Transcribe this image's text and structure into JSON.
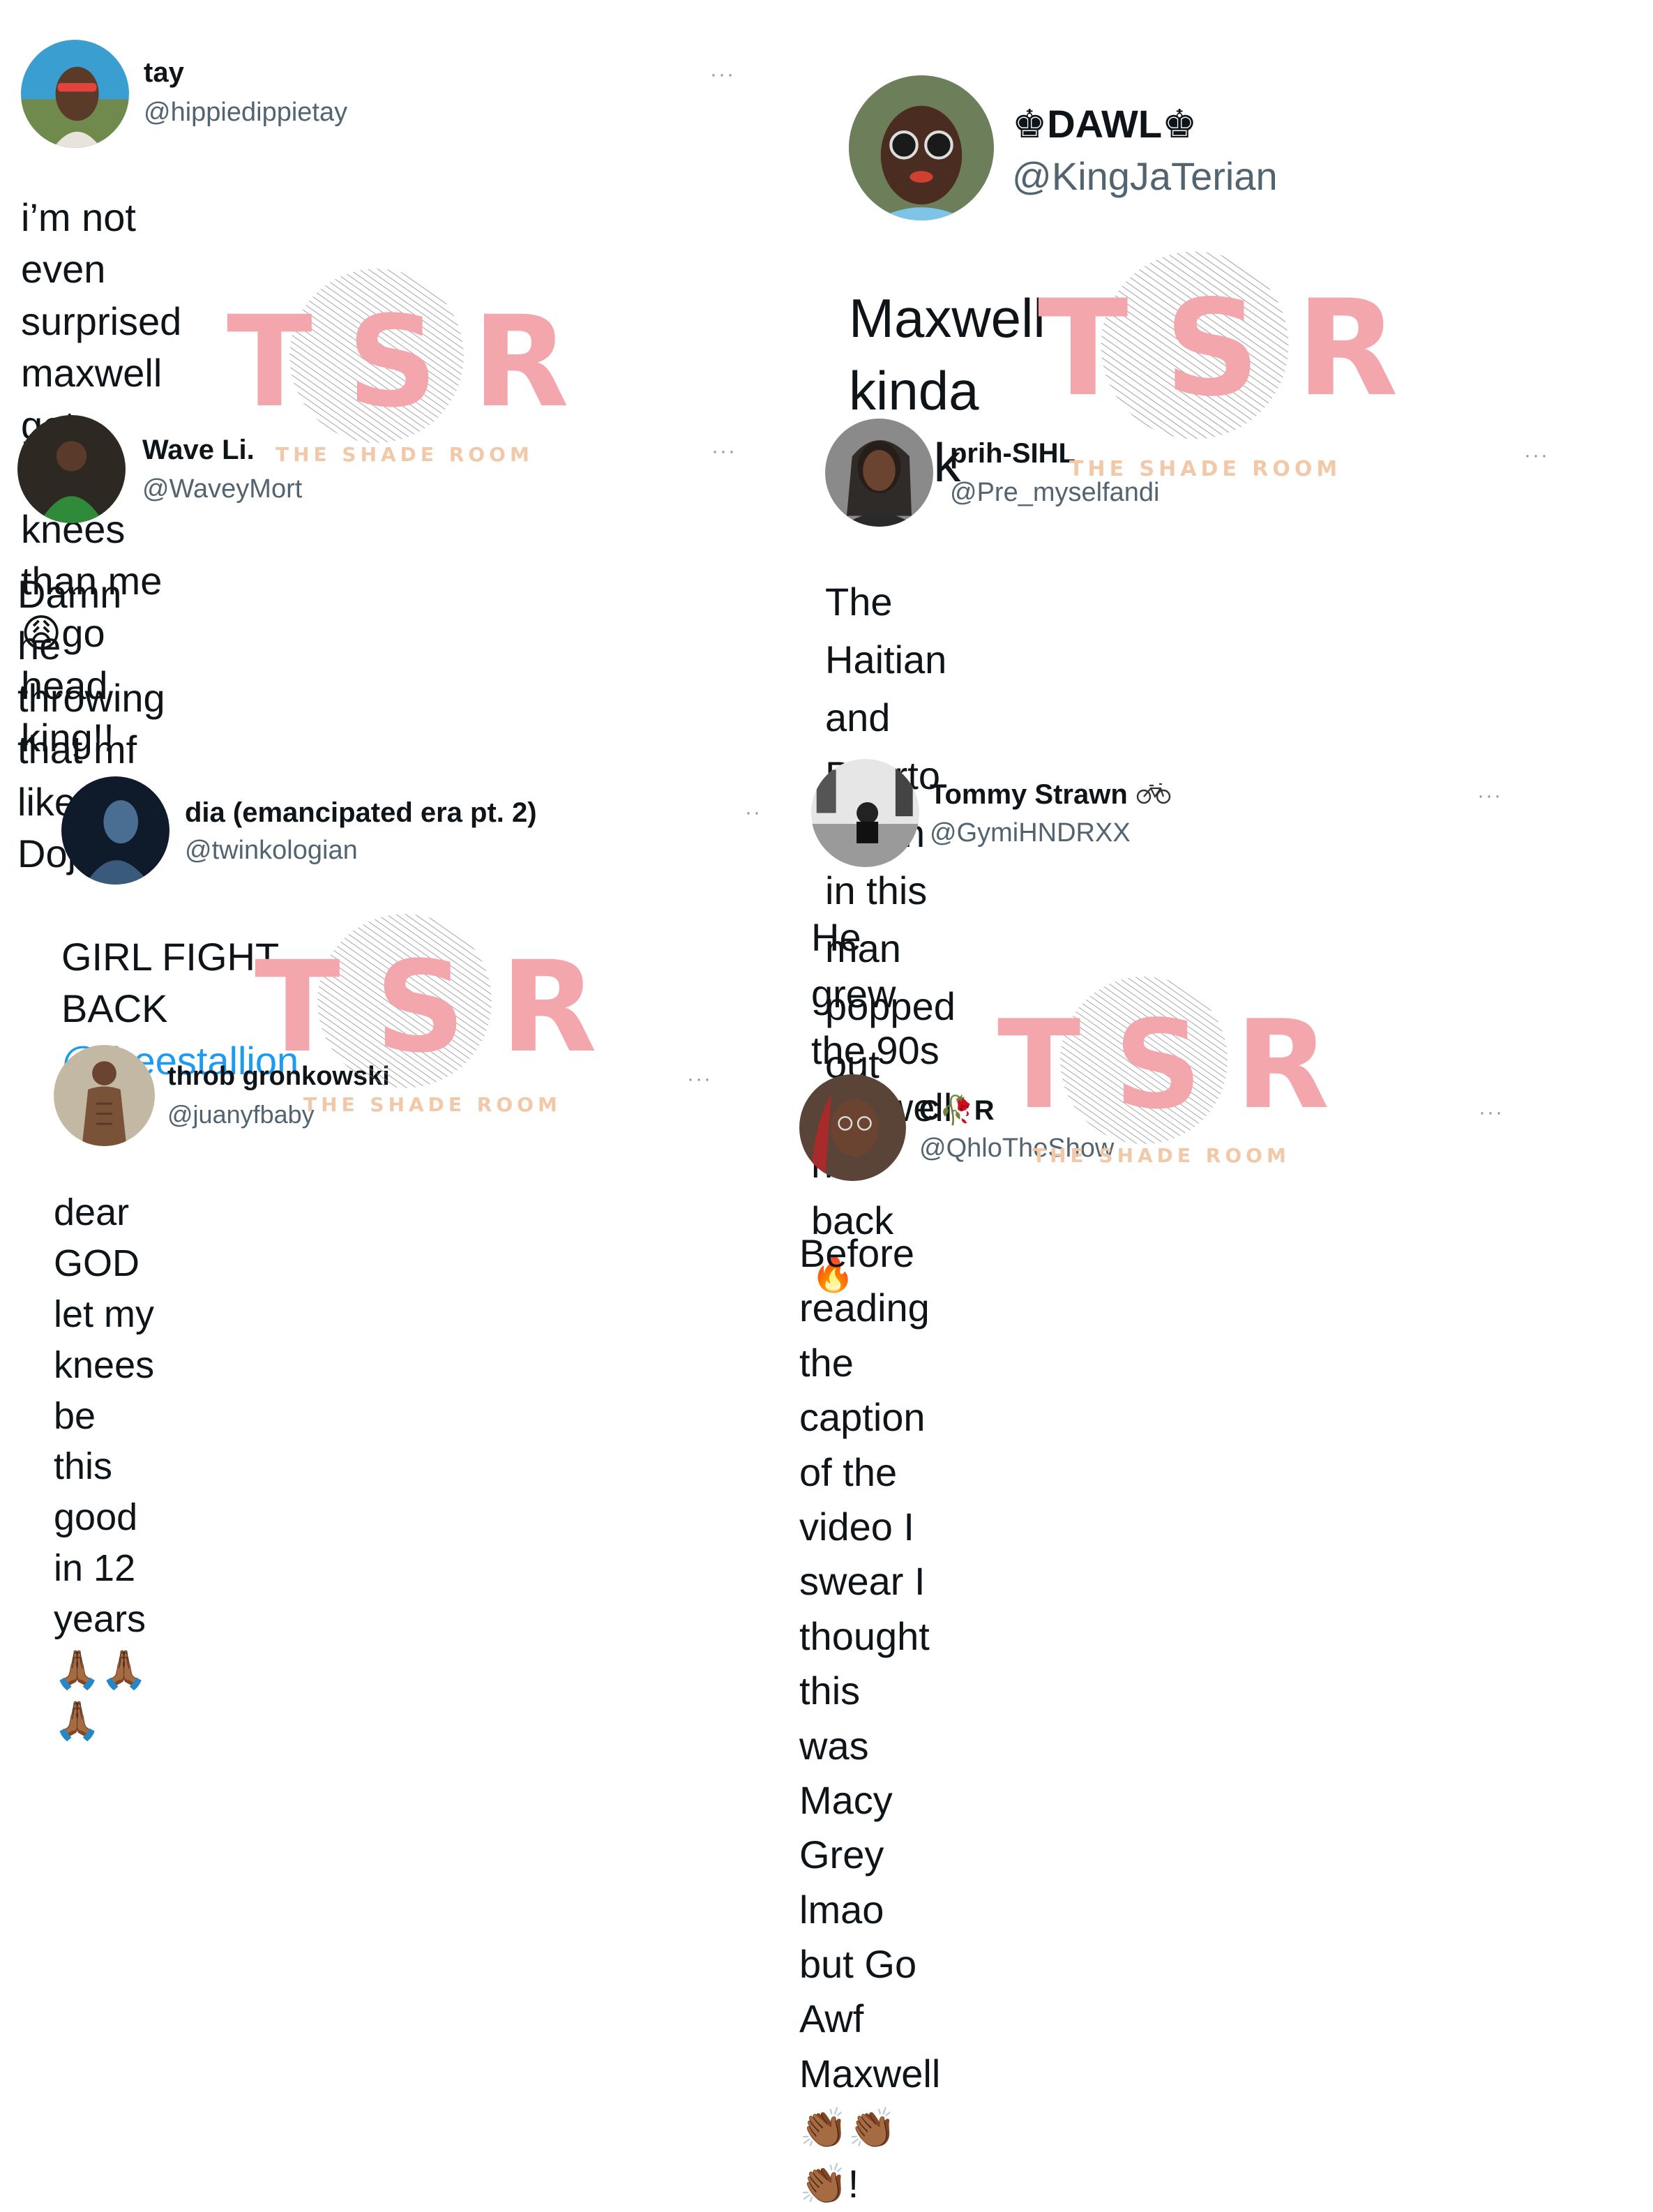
{
  "watermark": {
    "letters": "TSR",
    "subtitle": "THE SHADE ROOM"
  },
  "tweets": [
    {
      "name": "tay",
      "handle": "@hippiedippietay",
      "more": "···",
      "lines": [
        "i’m not even surprised maxwell got",
        "better knees than me",
        "😩",
        "go head",
        "king!!"
      ]
    },
    {
      "name": "♚DAWL♚",
      "handle": "@KingJaTerian",
      "lines": [
        "Maxwell kinda thick"
      ]
    },
    {
      "name": "Wave Li.",
      "handle": "@WaveyMort",
      "more": "···",
      "lines": [
        "Damn he throwing that mf like Doja"
      ]
    },
    {
      "name": "prih-SIHL",
      "handle": "@Pre_myselfandi",
      "more": "···",
      "lines": [
        "The Haitian and Puerto Rican in this",
        "man popped out LOL"
      ]
    },
    {
      "name": "dia (emancipated era pt. 2)",
      "handle": "@twinkologian",
      "more": "··",
      "lines": [
        "GIRL FIGHT BACK ",
        "@theestallion"
      ]
    },
    {
      "name": "Tommy Strawn",
      "name_icon": "bicycle-icon",
      "handle": "@GymiHNDRXX",
      "more": "···",
      "lines": [
        "He grew the 90s Maxwell hair back",
        "🔥"
      ]
    },
    {
      "name": "throb gronkowski",
      "handle": "@juanyfbaby",
      "more": "···",
      "lines": [
        "dear GOD let my knees be this good",
        "in 12 years ",
        "🙏🏾🙏🏾🙏🏾"
      ]
    },
    {
      "name": "C",
      "name_emoji": "🥀",
      "name_end": "R",
      "handle": "@QhloTheShow",
      "more": "···",
      "lines": [
        "Before reading the caption of the",
        "video I swear I thought this was Macy",
        "Grey lmao but Go Awf Maxwell ",
        "👏🏾👏🏾",
        "👏🏾",
        "!"
      ]
    }
  ]
}
